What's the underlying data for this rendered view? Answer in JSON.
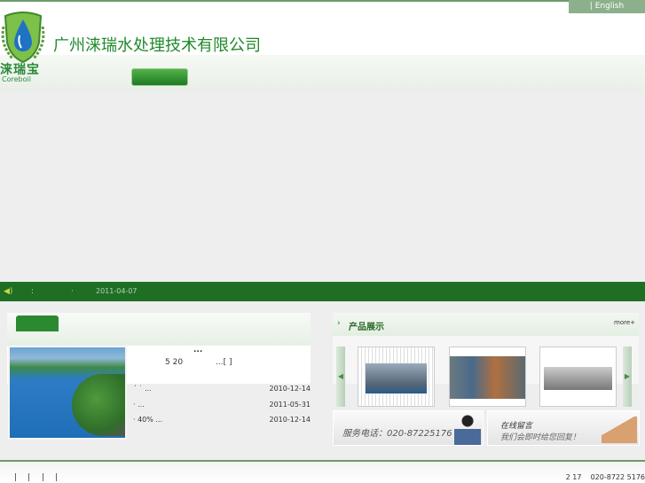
{
  "header": {
    "lang_link": "| English",
    "company_name": "广州涞瑞水处理技术有限公司",
    "logo_cn": "涞瑞宝",
    "logo_en": "Coreboil"
  },
  "ticker": {
    "icon": "speaker-icon",
    "colon": ":",
    "dot": "·",
    "date": "2011-04-07"
  },
  "news": {
    "featured": {
      "title": "...",
      "snippet_num": "5 20",
      "more": "...[ ]"
    },
    "items": [
      {
        "title": "ˊ ˙      ...",
        "date": "2010-12-14"
      },
      {
        "title": "·          ...",
        "date": "2011-05-31"
      },
      {
        "title": "·  40%       ...",
        "date": "2010-12-14"
      }
    ]
  },
  "products": {
    "title": "产品展示",
    "more": "more+"
  },
  "service": {
    "phone_label": "服务电话：020-87225176",
    "msg_title": "在线留言",
    "msg_sub": "我们会即时给您回复！"
  },
  "footer": {
    "links": [
      "|",
      "|",
      "|",
      "|"
    ],
    "contact": "2 17    020-8722 5176"
  },
  "colors": {
    "brand_green": "#1e6f24",
    "accent": "#2b8a2f"
  }
}
